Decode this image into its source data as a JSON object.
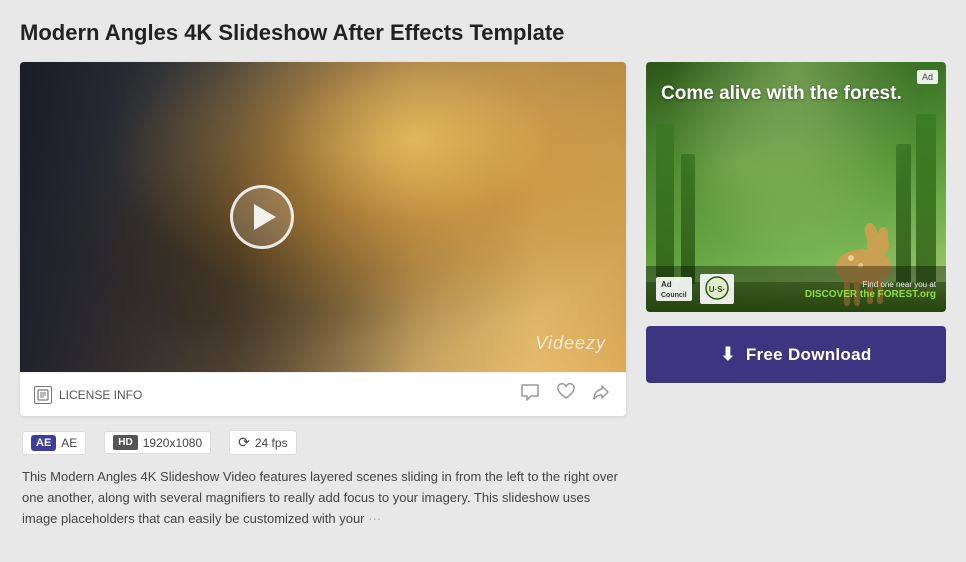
{
  "page": {
    "title": "Modern Angles 4K Slideshow After Effects Template"
  },
  "video": {
    "watermark": "Videezy",
    "license_label": "LICENSE INFO",
    "resolution": "1920x1080",
    "fps": "24 fps",
    "ae_label": "AE",
    "hd_label": "HD",
    "description": "This Modern Angles 4K Slideshow Video features layered scenes sliding in from the left to the right over one another, along with several magnifiers to really add focus to your imagery. This slideshow uses image placeholders that can easily be customized with your",
    "description_more": "···"
  },
  "ad": {
    "text": "Come alive with the forest.",
    "corner_badge": "Ad",
    "logo1": "Ad Council",
    "logo2": "U·S·",
    "cta_text": "Find one near you at",
    "cta_brand": "DISCOVER the FOREST.org"
  },
  "download": {
    "label": "Free Download"
  },
  "icons": {
    "play": "▶",
    "comment": "💬",
    "heart": "♡",
    "share": "↗",
    "download_arrow": "⬇"
  }
}
